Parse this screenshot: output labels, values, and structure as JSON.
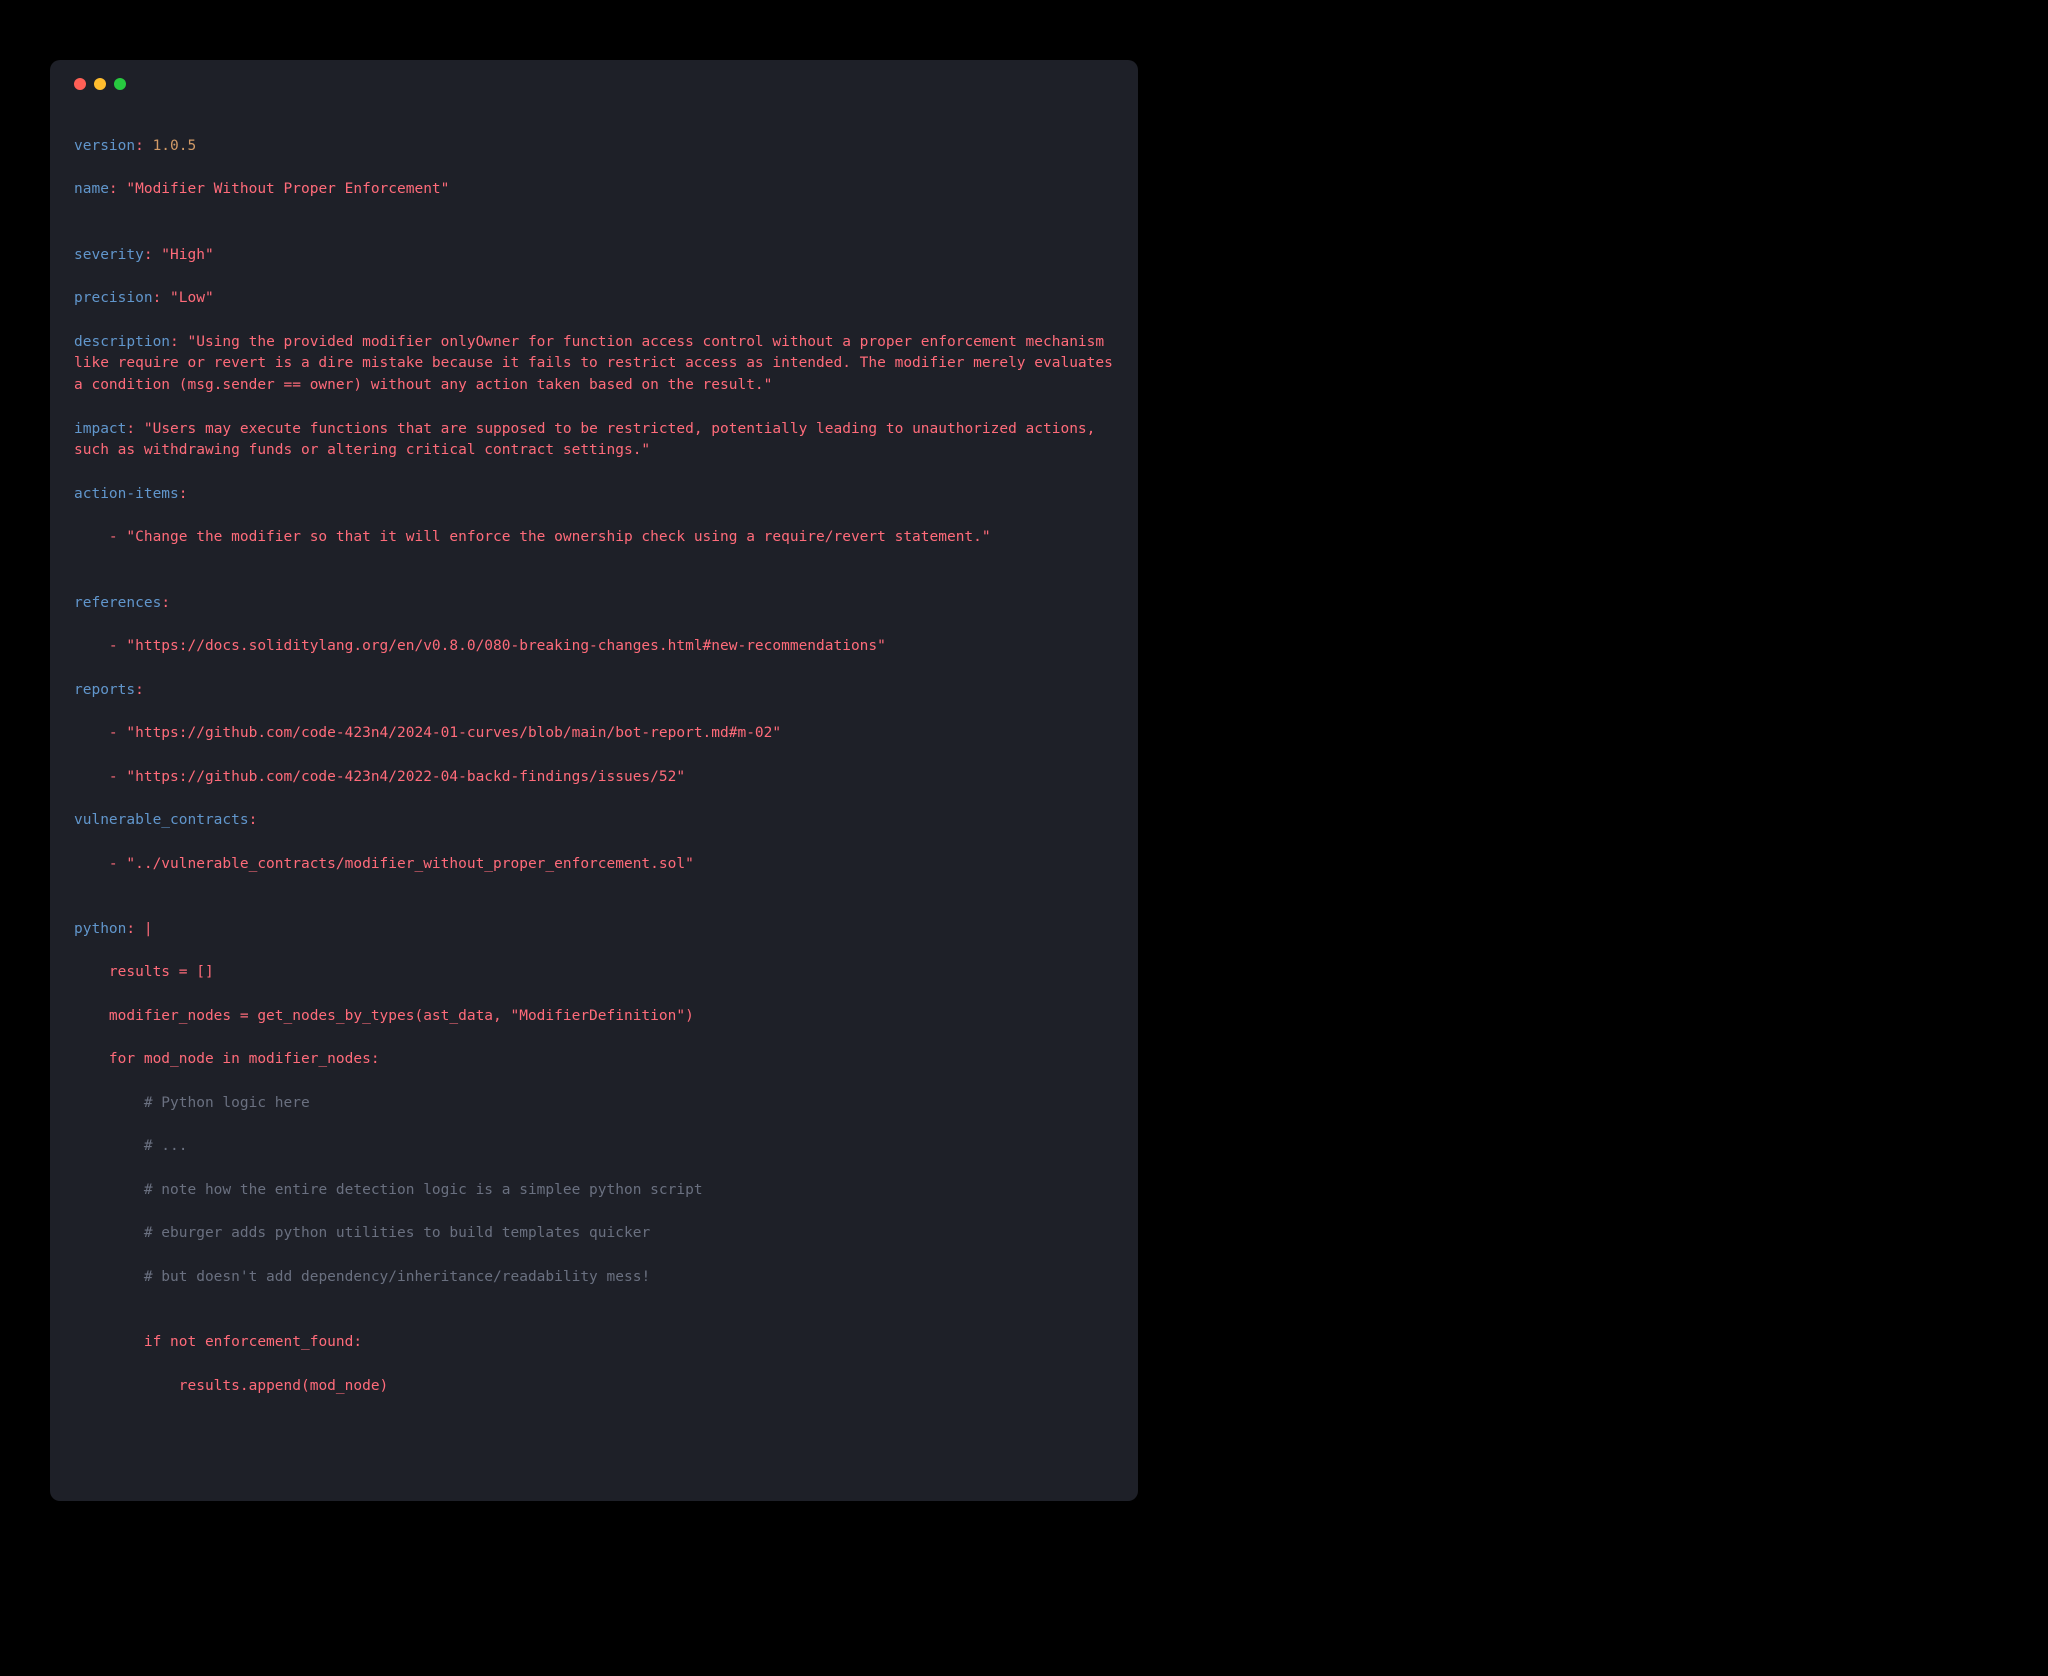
{
  "yaml": {
    "version_key": "version",
    "version_val": " 1.0.5",
    "name_key": "name",
    "name_val": " \"Modifier Without Proper Enforcement\"",
    "severity_key": "severity",
    "severity_val": " \"High\"",
    "precision_key": "precision",
    "precision_val": " \"Low\"",
    "description_key": "description",
    "description_val": " \"Using the provided modifier onlyOwner for function access control without a proper enforcement mechanism like require or revert is a dire mistake because it fails to restrict access as intended. The modifier merely evaluates a condition (msg.sender == owner) without any action taken based on the result.\"",
    "impact_key": "impact",
    "impact_val": " \"Users may execute functions that are supposed to be restricted, potentially leading to unauthorized actions, such as withdrawing funds or altering critical contract settings.\"",
    "action_items_key": "action-items",
    "action_item_1": "    - \"Change the modifier so that it will enforce the ownership check using a require/revert statement.\"",
    "references_key": "references",
    "reference_1": "    - \"https://docs.soliditylang.org/en/v0.8.0/080-breaking-changes.html#new-recommendations\"",
    "reports_key": "reports",
    "report_1": "    - \"https://github.com/code-423n4/2024-01-curves/blob/main/bot-report.md#m-02\"",
    "report_2": "    - \"https://github.com/code-423n4/2022-04-backd-findings/issues/52\"",
    "vulnerable_contracts_key": "vulnerable_contracts",
    "vulnerable_contract_1": "    - \"../vulnerable_contracts/modifier_without_proper_enforcement.sol\"",
    "python_key": "python",
    "python_pipe": " |",
    "py_line_1": "    results = []",
    "py_line_2": "    modifier_nodes = get_nodes_by_types(ast_data, \"ModifierDefinition\")",
    "py_line_3": "    for mod_node in modifier_nodes:",
    "py_comment_1": "        # Python logic here",
    "py_comment_2": "        # ...",
    "py_comment_3": "        # note how the entire detection logic is a simplee python script",
    "py_comment_4": "        # eburger adds python utilities to build templates quicker",
    "py_comment_5": "        # but doesn't add dependency/inheritance/readability mess!",
    "py_line_4": "        if not enforcement_found:",
    "py_line_5": "            results.append(mod_node)",
    "colon": ":"
  }
}
